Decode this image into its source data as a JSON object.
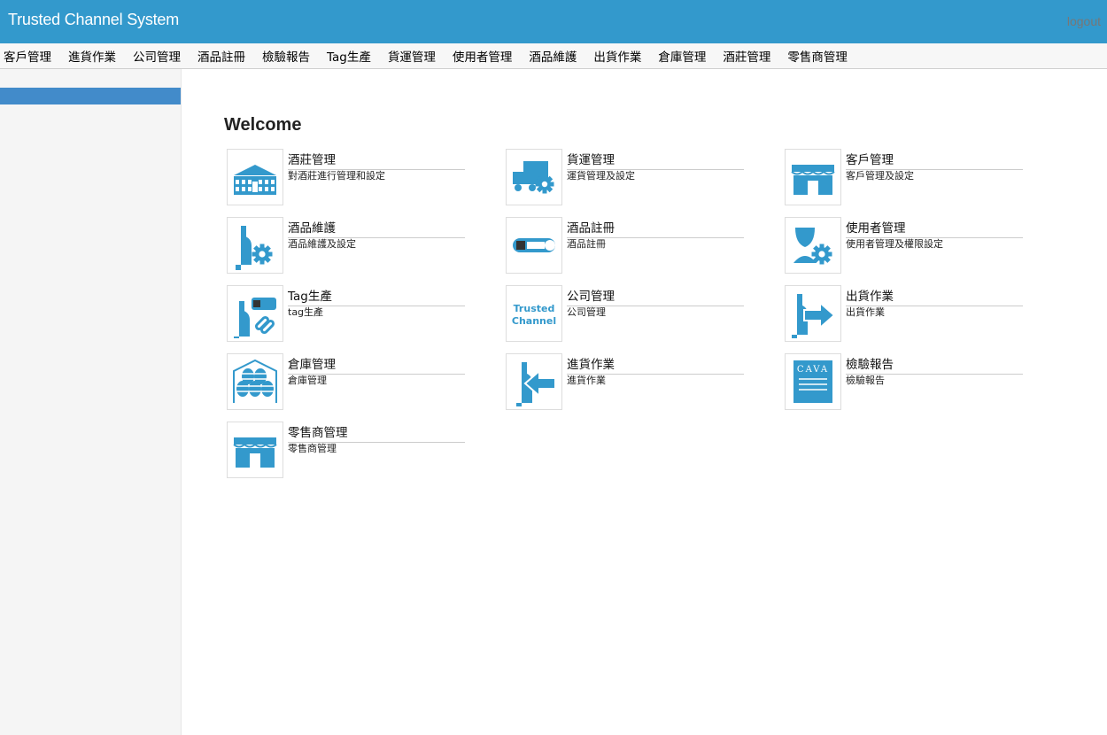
{
  "header": {
    "title": "Trusted Channel System",
    "logout": "logout"
  },
  "menu": [
    "客戶管理",
    "進貨作業",
    "公司管理",
    "酒品註冊",
    "檢驗報告",
    "Tag生產",
    "貨運管理",
    "使用者管理",
    "酒品維護",
    "出貨作業",
    "倉庫管理",
    "酒莊管理",
    "零售商管理"
  ],
  "main": {
    "welcome": "Welcome",
    "tiles": [
      {
        "title": "酒莊管理",
        "desc": "對酒莊進行管理和設定",
        "icon": "winery-building-icon"
      },
      {
        "title": "貨運管理",
        "desc": "運貨管理及設定",
        "icon": "truck-gear-icon"
      },
      {
        "title": "客戶管理",
        "desc": "客戶管理及設定",
        "icon": "storefront-icon"
      },
      {
        "title": "酒品維護",
        "desc": "酒品維護及設定",
        "icon": "bottle-gear-icon"
      },
      {
        "title": "酒品註冊",
        "desc": "酒品註冊",
        "icon": "tag-label-icon"
      },
      {
        "title": "使用者管理",
        "desc": "使用者管理及權限設定",
        "icon": "user-gear-icon"
      },
      {
        "title": "Tag生產",
        "desc": "tag生產",
        "icon": "bottle-tag-link-icon"
      },
      {
        "title": "公司管理",
        "desc": "公司管理",
        "icon": "trusted-channel-logo-icon",
        "logo_text": [
          "Trusted",
          "Channel"
        ]
      },
      {
        "title": "出貨作業",
        "desc": "出貨作業",
        "icon": "bottle-arrow-out-icon"
      },
      {
        "title": "倉庫管理",
        "desc": "倉庫管理",
        "icon": "warehouse-barrels-icon"
      },
      {
        "title": "進貨作業",
        "desc": "進貨作業",
        "icon": "bottle-arrow-in-icon"
      },
      {
        "title": "檢驗報告",
        "desc": "檢驗報告",
        "icon": "cava-report-icon",
        "logo_text": [
          "CAVA"
        ]
      },
      {
        "title": "零售商管理",
        "desc": "零售商管理",
        "icon": "storefront-icon"
      }
    ]
  },
  "colors": {
    "header": "#3399cc",
    "icon": "#3399cc",
    "sidebar_active": "#428bca"
  }
}
